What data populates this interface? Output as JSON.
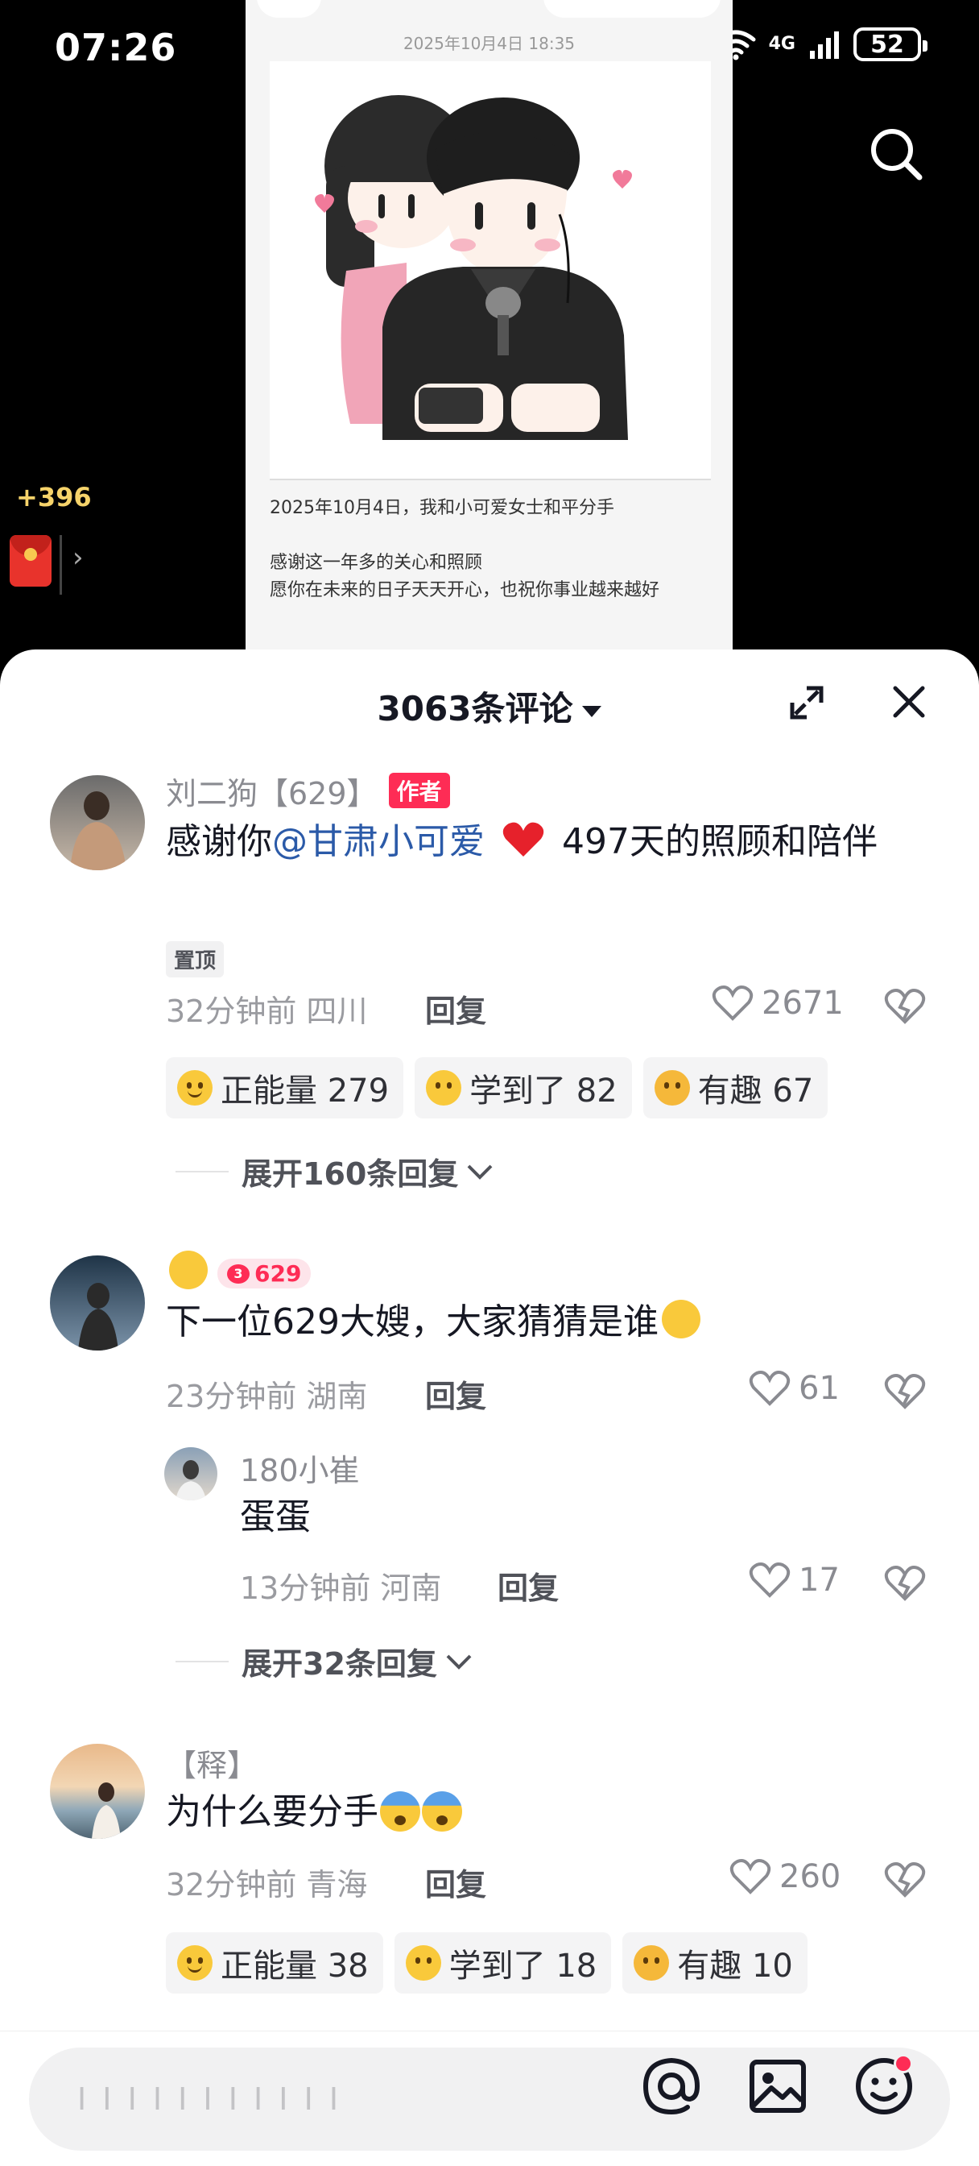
{
  "status_bar": {
    "time": "07:26",
    "network": "4G",
    "battery": "52"
  },
  "top": {
    "coins": "+396"
  },
  "post": {
    "date": "2025年10月4日 18:35",
    "lines": [
      "2025年10月4日，我和小可爱女士和平分手",
      "感谢这一年多的关心和照顾",
      "愿你在未来的日子天天开心，也祝你事业越来越好"
    ]
  },
  "comments_panel": {
    "title": "3063条评论"
  },
  "comments": [
    {
      "username": "刘二狗【629】",
      "author_tag": "作者",
      "text_before": "感谢你",
      "mention": "@甘肃小可爱",
      "text_after": " 497天的照顾和陪伴",
      "pinned": "置顶",
      "meta": "32分钟前 四川",
      "reply": "回复",
      "likes": "2671",
      "reactions": [
        {
          "emoji": "hug-emoji",
          "label": "正能量 279"
        },
        {
          "emoji": "learned-emoji",
          "label": "学到了 82"
        },
        {
          "emoji": "funny-emoji",
          "label": "有趣 67"
        }
      ],
      "expand": "展开160条回复"
    },
    {
      "level": "629",
      "text": "下一位629大嫂，大家猜猜是谁",
      "meta": "23分钟前 湖南",
      "reply": "回复",
      "likes": "61",
      "sub_reply": {
        "username": "180小崔",
        "text": "蛋蛋",
        "meta": "13分钟前 河南",
        "reply": "回复",
        "likes": "17"
      },
      "expand": "展开32条回复"
    },
    {
      "username": "【释】",
      "text": "为什么要分手",
      "meta": "32分钟前 青海",
      "reply": "回复",
      "likes": "260",
      "reactions": [
        {
          "emoji": "hug-emoji",
          "label": "正能量 38"
        },
        {
          "emoji": "learned-emoji",
          "label": "学到了 18"
        },
        {
          "emoji": "funny-emoji",
          "label": "有趣 10"
        }
      ]
    }
  ],
  "input": {
    "placeholder": "I I I I I I I I I I I"
  },
  "colors": {
    "accent": "#fe2c55",
    "mention": "#2b5aa8",
    "coins": "#f6d36a"
  }
}
